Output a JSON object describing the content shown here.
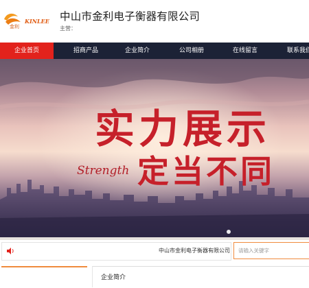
{
  "header": {
    "logo": {
      "brand_text": "KINLEE",
      "mark_text": "金利",
      "icon": "kinlee-logo"
    },
    "title": "中山市金利电子衡器有限公司",
    "main_business": "主营："
  },
  "nav": {
    "items": [
      {
        "label": "企业首页",
        "active": true
      },
      {
        "label": "招商产品",
        "active": false
      },
      {
        "label": "企业简介",
        "active": false
      },
      {
        "label": "公司相册",
        "active": false
      },
      {
        "label": "在线留言",
        "active": false
      },
      {
        "label": "联系我们",
        "active": false
      }
    ]
  },
  "banner": {
    "headline_1": "实力展示",
    "headline_2": "定当不同",
    "english": "Strength"
  },
  "notice": {
    "icon": "speaker-icon",
    "text": "中山市金利电子衡器有限公司"
  },
  "search": {
    "placeholder": "请输入关键字"
  },
  "intro": {
    "title": "企业简介"
  },
  "colors": {
    "nav_bg": "#1c2236",
    "active": "#e2221c",
    "accent": "#f08a3c",
    "calligraphy": "#c6202a"
  }
}
